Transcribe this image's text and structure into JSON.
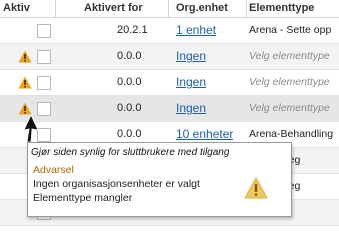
{
  "columns": {
    "active": "Aktiv",
    "activated_for": "Aktivert for",
    "org_unit": "Org.enhet",
    "element_type": "Elementtype"
  },
  "rows": [
    {
      "warning": false,
      "version": "20.2.1",
      "org": "1 enhet",
      "type": "Arena - Sette opp",
      "type_hint": false
    },
    {
      "warning": true,
      "version": "0.0.0",
      "org": "Ingen",
      "type": "Velg elementtype",
      "type_hint": true
    },
    {
      "warning": true,
      "version": "0.0.0",
      "org": "Ingen",
      "type": "Velg elementtype",
      "type_hint": true
    },
    {
      "warning": true,
      "version": "0.0.0",
      "org": "Ingen",
      "type": "Velg elementtype",
      "type_hint": true
    },
    {
      "warning": false,
      "version": "0.0.0",
      "org": "10 enheter",
      "type": "Arena-Behandling",
      "type_hint": false
    },
    {
      "warning": false,
      "version": "",
      "org": "",
      "type": "Intensivreg",
      "type_hint": false
    },
    {
      "warning": false,
      "version": "",
      "org": "",
      "type": "Intensivreg",
      "type_hint": false
    },
    {
      "warning": false,
      "version": "",
      "org": "",
      "type": "",
      "type_hint": false
    }
  ],
  "tooltip": {
    "heading": "Gjør siden synlig for sluttbrukere med tilgang",
    "title": "Advarsel",
    "line1": "Ingen organisasjonsenheter er valgt",
    "line2": "Elementtype mangler",
    "icon": "warning-icon"
  },
  "colors": {
    "warning": "#e8a317",
    "link": "#1a5fb4",
    "tooltip_title": "#b06a00"
  }
}
